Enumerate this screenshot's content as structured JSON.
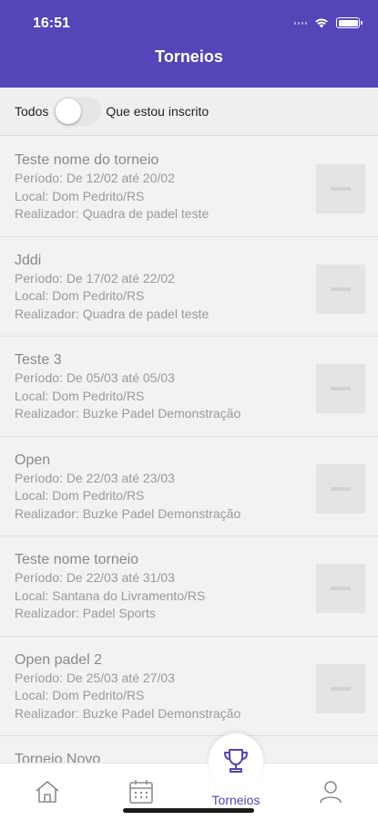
{
  "status_bar": {
    "time": "16:51"
  },
  "header": {
    "title": "Torneios"
  },
  "filter": {
    "left_label": "Todos",
    "right_label": "Que estou inscrito"
  },
  "tournaments": [
    {
      "name": "Teste nome do torneio",
      "period": "Período: De 12/02 até 20/02",
      "location": "Local: Dom Pedrito/RS",
      "organizer": "Realizador: Quadra de padel teste"
    },
    {
      "name": "Jddi",
      "period": "Período: De 17/02 até 22/02",
      "location": "Local: Dom Pedrito/RS",
      "organizer": "Realizador: Quadra de padel teste"
    },
    {
      "name": "Teste 3",
      "period": "Período: De 05/03 até 05/03",
      "location": "Local: Dom Pedrito/RS",
      "organizer": "Realizador: Buzke Padel Demonstração"
    },
    {
      "name": "Open",
      "period": "Período: De 22/03 até 23/03",
      "location": "Local: Dom Pedrito/RS",
      "organizer": "Realizador: Buzke Padel Demonstração"
    },
    {
      "name": "Teste nome torneio",
      "period": "Período: De 22/03 até 31/03",
      "location": "Local: Santana do Livramento/RS",
      "organizer": "Realizador: Padel Sports"
    },
    {
      "name": "Open padel 2",
      "period": "Período: De 25/03 até 27/03",
      "location": "Local: Dom Pedrito/RS",
      "organizer": "Realizador: Buzke Padel Demonstração"
    },
    {
      "name": "Torneio Novo",
      "period": "",
      "location": "",
      "organizer": ""
    }
  ],
  "tabbar": {
    "active_label": "Torneios",
    "tabs": [
      {
        "icon": "home-icon"
      },
      {
        "icon": "calendar-icon"
      },
      {
        "icon": "trophy-icon"
      },
      {
        "icon": "profile-icon"
      }
    ]
  },
  "colors": {
    "accent": "#5445b8",
    "header_bg": "#5445b8"
  }
}
